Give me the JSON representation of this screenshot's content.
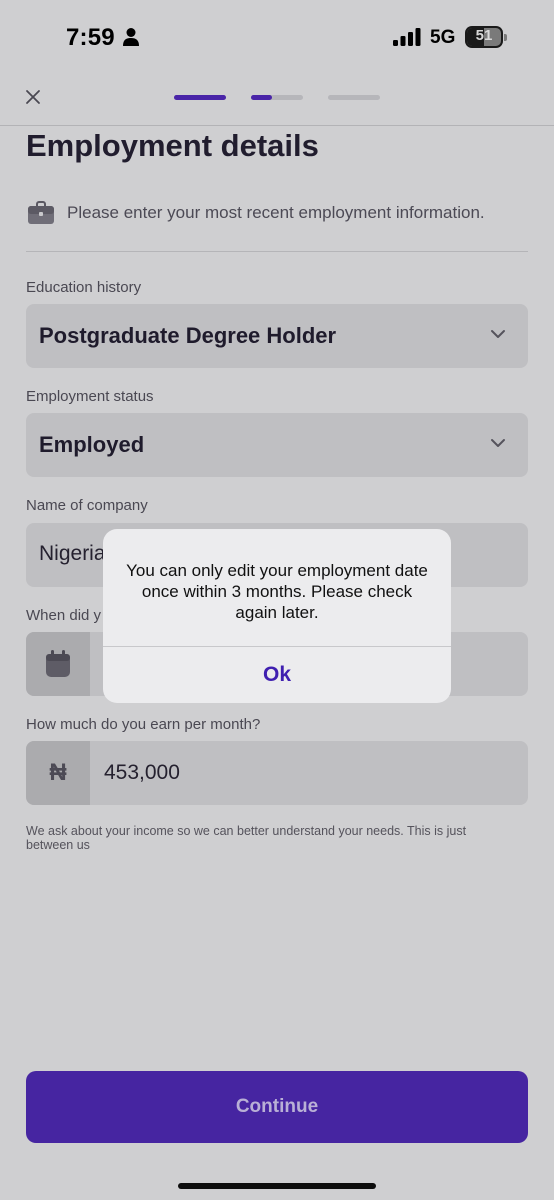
{
  "status_bar": {
    "time": "7:59",
    "network": "5G",
    "battery": "51"
  },
  "header": {
    "close_icon": "close-icon",
    "progress_steps": [
      1.0,
      0.4,
      0.0
    ],
    "accent": "#4a25a8"
  },
  "page": {
    "title": "Employment details",
    "info_icon": "briefcase-icon",
    "info_text": "Please enter your most recent employment information."
  },
  "fields": {
    "education": {
      "label": "Education history",
      "value": "Postgraduate Degree Holder"
    },
    "employment_status": {
      "label": "Employment status",
      "value": "Employed"
    },
    "company": {
      "label": "Name of company",
      "value": "Nigeria"
    },
    "start_date": {
      "label": "When did y"
    },
    "income": {
      "label": "How much do you earn per month?",
      "currency": "₦",
      "value": "453,000"
    }
  },
  "disclaimer": "We ask about your income so we can better understand your needs. This is just between us",
  "continue_label": "Continue",
  "alert": {
    "message": "You can only edit your employment date once within 3 months. Please check again later.",
    "ok_label": "Ok"
  }
}
